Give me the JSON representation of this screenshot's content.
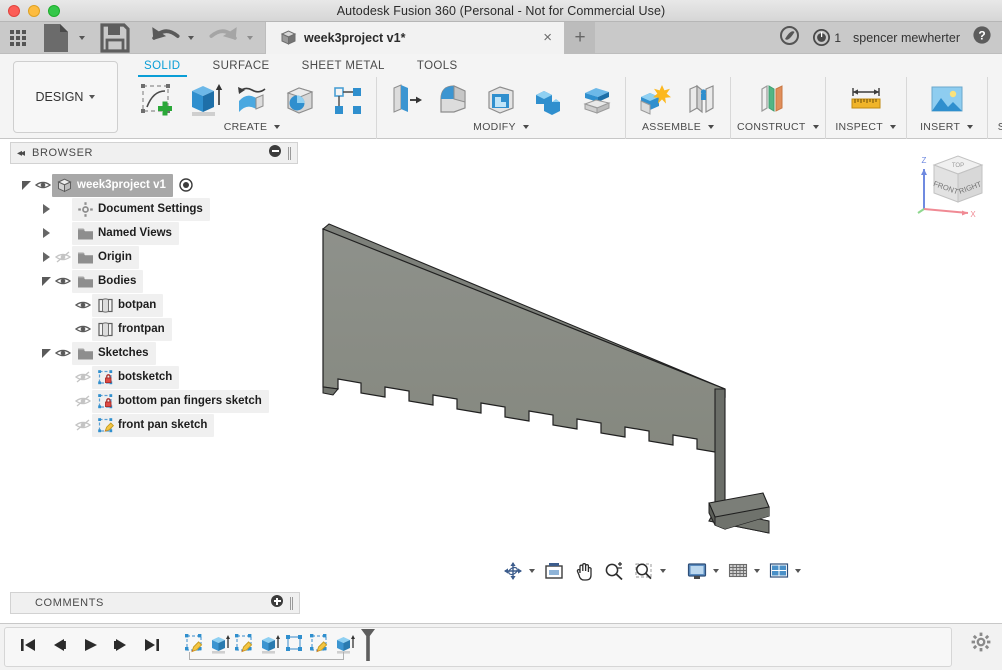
{
  "window": {
    "title": "Autodesk Fusion 360 (Personal - Not for Commercial Use)",
    "controls": {
      "close": "close",
      "minimize": "minimize",
      "maximize": "maximize"
    }
  },
  "quick_access": {
    "app_grid": "app-grid",
    "file": "File",
    "save": "Save",
    "undo": "Undo",
    "redo": "Redo",
    "tab": {
      "name": "week3project v1*",
      "close": "×"
    },
    "new_tab": "+",
    "extensions_icon": "extensions-icon",
    "job_status_icon": "job-status-icon",
    "job_count": "1",
    "username": "spencer mewherter",
    "help": "?"
  },
  "ribbon": {
    "design_menu": "DESIGN",
    "workspace_tabs": [
      {
        "label": "SOLID",
        "active": true
      },
      {
        "label": "SURFACE",
        "active": false
      },
      {
        "label": "SHEET METAL",
        "active": false
      },
      {
        "label": "TOOLS",
        "active": false
      }
    ],
    "panels": [
      {
        "label": "CREATE",
        "has_dropdown": true,
        "tools": [
          "create-sketch-icon",
          "extrude-icon",
          "revolve-icon",
          "sweep-icon",
          "pattern-icon"
        ]
      },
      {
        "label": "MODIFY",
        "has_dropdown": true,
        "tools": [
          "press-pull-icon",
          "fillet-icon",
          "shell-icon",
          "combine-icon",
          "split-face-icon"
        ]
      },
      {
        "label": "ASSEMBLE",
        "has_dropdown": true,
        "tools": [
          "new-component-icon",
          "joint-icon"
        ]
      },
      {
        "label": "CONSTRUCT",
        "has_dropdown": true,
        "tools": [
          "offset-plane-icon"
        ]
      },
      {
        "label": "INSPECT",
        "has_dropdown": true,
        "tools": [
          "measure-icon"
        ]
      },
      {
        "label": "INSERT",
        "has_dropdown": true,
        "tools": [
          "insert-image-icon"
        ]
      },
      {
        "label": "SELECT",
        "has_dropdown": true,
        "tools": [
          "select-icon"
        ]
      }
    ]
  },
  "browser": {
    "header": {
      "collapse": "◂◂",
      "title": "BROWSER",
      "minimize": "minimize-panel"
    },
    "tree": [
      {
        "label": "week3project v1",
        "indent": 0,
        "expander": "down",
        "visibility": "visible",
        "icon": "component-icon",
        "selected": true,
        "has_radio": true
      },
      {
        "label": "Document Settings",
        "indent": 1,
        "expander": "right",
        "visibility": "none",
        "icon": "gear-icon",
        "selected": false,
        "has_radio": false
      },
      {
        "label": "Named Views",
        "indent": 1,
        "expander": "right",
        "visibility": "none",
        "icon": "folder-icon",
        "selected": false,
        "has_radio": false
      },
      {
        "label": "Origin",
        "indent": 1,
        "expander": "right",
        "visibility": "hidden",
        "icon": "folder-icon",
        "selected": false,
        "has_radio": false
      },
      {
        "label": "Bodies",
        "indent": 1,
        "expander": "down",
        "visibility": "visible",
        "icon": "folder-icon",
        "selected": false,
        "has_radio": false
      },
      {
        "label": "botpan",
        "indent": 2,
        "expander": "none",
        "visibility": "visible",
        "icon": "body-icon",
        "selected": false,
        "has_radio": false
      },
      {
        "label": "frontpan",
        "indent": 2,
        "expander": "none",
        "visibility": "visible",
        "icon": "body-icon",
        "selected": false,
        "has_radio": false
      },
      {
        "label": "Sketches",
        "indent": 1,
        "expander": "down",
        "visibility": "visible",
        "icon": "folder-icon",
        "selected": false,
        "has_radio": false
      },
      {
        "label": "botsketch",
        "indent": 2,
        "expander": "none",
        "visibility": "hidden",
        "icon": "sketch-locked-icon",
        "selected": false,
        "has_radio": false
      },
      {
        "label": "bottom pan fingers sketch",
        "indent": 2,
        "expander": "none",
        "visibility": "hidden",
        "icon": "sketch-locked-icon",
        "selected": false,
        "has_radio": false
      },
      {
        "label": "front pan sketch",
        "indent": 2,
        "expander": "none",
        "visibility": "hidden",
        "icon": "sketch-icon",
        "selected": false,
        "has_radio": false
      }
    ]
  },
  "comments": {
    "title": "COMMENTS",
    "add": "add-comment"
  },
  "canvas": {
    "view_cube": {
      "front_label": "FRONT",
      "right_label": "RIGHT",
      "axis_x": "X",
      "axis_y": "Y",
      "axis_z": "Z"
    },
    "model": {
      "name": "front panel with finger joints and bottom pan",
      "body_color": "#8a8d87",
      "edge_color": "#2a2a2a"
    },
    "view_toolbar": [
      {
        "name": "orbit-icon",
        "dropdown": true
      },
      {
        "name": "look-at-icon",
        "dropdown": false
      },
      {
        "name": "pan-icon",
        "dropdown": false
      },
      {
        "name": "zoom-icon",
        "dropdown": false
      },
      {
        "name": "zoom-window-icon",
        "dropdown": true
      },
      {
        "name": "display-settings-icon",
        "dropdown": true
      },
      {
        "name": "grid-snap-icon",
        "dropdown": true
      },
      {
        "name": "viewports-icon",
        "dropdown": true
      }
    ]
  },
  "timeline": {
    "nav": [
      "go-to-beginning",
      "step-back",
      "play",
      "step-forward",
      "go-to-end"
    ],
    "features": [
      "sketch-icon",
      "extrude-icon",
      "sketch-icon",
      "extrude-icon",
      "construction-icon",
      "sketch-icon",
      "extrude-icon"
    ],
    "marker": "timeline-playhead",
    "settings": "settings-gear"
  },
  "colors": {
    "accent_blue": "#0a9ed6",
    "tool_blue": "#2196d6",
    "titlebar": "#e0e0e0",
    "ribbon_bg": "#f4f4f4",
    "model_gray": "#8a8d87"
  }
}
